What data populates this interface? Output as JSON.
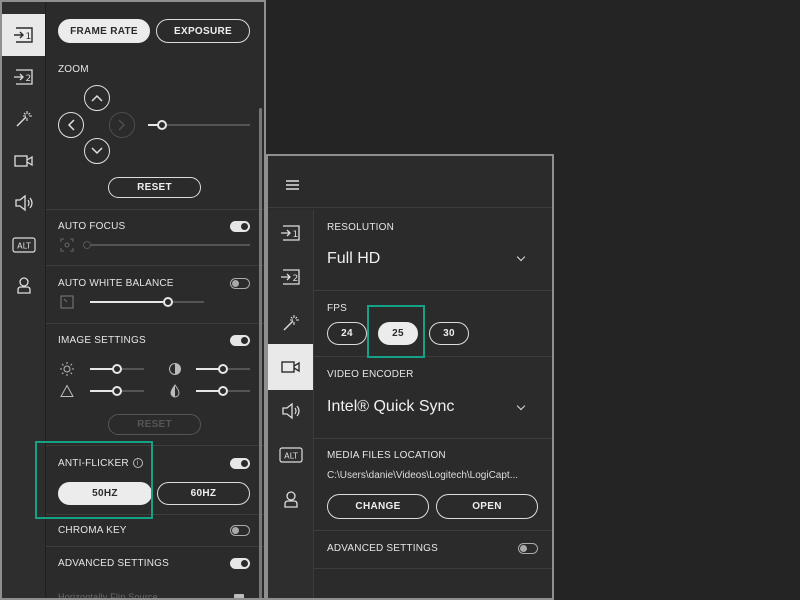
{
  "left_panel": {
    "tabs": [
      {
        "label": "FRAME RATE",
        "active": true
      },
      {
        "label": "EXPOSURE",
        "active": false
      }
    ],
    "zoom": {
      "label": "ZOOM",
      "level": 0.14,
      "reset_label": "RESET"
    },
    "auto_focus": {
      "label": "AUTO FOCUS",
      "enabled": true,
      "value": 0.0
    },
    "auto_white_balance": {
      "label": "AUTO WHITE BALANCE",
      "enabled": false,
      "value": 0.68
    },
    "image_settings": {
      "label": "IMAGE SETTINGS",
      "enabled": true,
      "brightness": 0.5,
      "contrast": 0.5,
      "sharpness": 0.5,
      "saturation": 0.5,
      "reset_label": "RESET"
    },
    "anti_flicker": {
      "label": "ANTI-FLICKER",
      "options": [
        "50HZ",
        "60HZ"
      ],
      "selected": "50HZ"
    },
    "chroma_key": {
      "label": "CHROMA KEY",
      "enabled": false
    },
    "advanced_settings": {
      "label": "ADVANCED SETTINGS",
      "enabled": true
    },
    "flip_source": {
      "label": "Horizontally Flip Source"
    }
  },
  "right_panel": {
    "menu_icon": "hamburger-icon",
    "resolution": {
      "label": "RESOLUTION",
      "value": "Full HD"
    },
    "fps": {
      "label": "FPS",
      "options": [
        "24",
        "25",
        "30"
      ],
      "selected": "25"
    },
    "video_encoder": {
      "label": "VIDEO ENCODER",
      "value": "Intel® Quick Sync"
    },
    "media_files_location": {
      "label": "MEDIA FILES LOCATION",
      "path": "C:\\Users\\danie\\Videos\\Logitech\\LogiCapt...",
      "change_label": "CHANGE",
      "open_label": "OPEN"
    },
    "advanced_settings": {
      "label": "ADVANCED SETTINGS",
      "enabled": false
    }
  },
  "rail": {
    "items": [
      {
        "icon": "source-1-icon"
      },
      {
        "icon": "source-2-icon"
      },
      {
        "icon": "magic-wand-icon"
      },
      {
        "icon": "video-camera-icon"
      },
      {
        "icon": "speaker-icon"
      },
      {
        "icon": "alt-icon",
        "text": "ALT"
      },
      {
        "icon": "user-icon"
      }
    ]
  },
  "colors": {
    "accent_highlight": "#14a186",
    "panel_bg": "#2b2b2b",
    "page_bg": "#242424"
  }
}
